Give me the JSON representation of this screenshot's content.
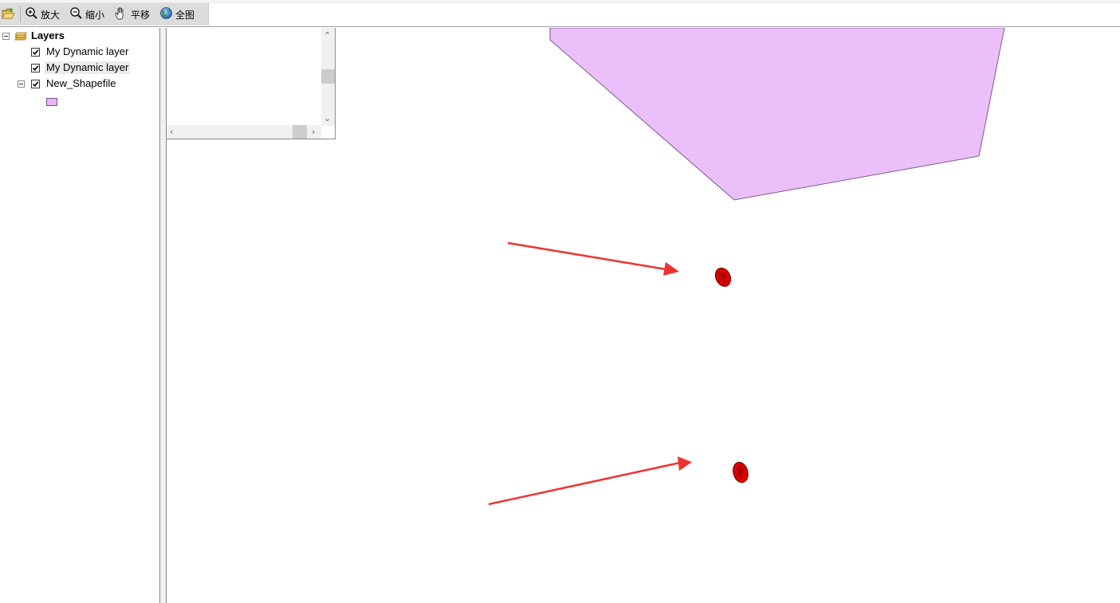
{
  "toolbar": {
    "zoom_in_label": "放大",
    "zoom_out_label": "缩小",
    "pan_label": "平移",
    "full_extent_label": "全图"
  },
  "toc": {
    "root_label": "Layers",
    "layers": [
      {
        "label": "My Dynamic layer",
        "checked": true
      },
      {
        "label": "My Dynamic layer",
        "checked": true
      },
      {
        "label": "New_Shapefile",
        "checked": true
      }
    ]
  },
  "colors": {
    "polygon_fill": "#ebbffa",
    "polygon_stroke": "#7d5a8c",
    "point_fill": "#dc0000",
    "arrow": "#ee3232",
    "legend_swatch": "#e8b8f5"
  },
  "icons": {
    "open": "folder-open-icon",
    "zoom_in": "zoom-in-icon",
    "zoom_out": "zoom-out-icon",
    "pan": "hand-icon",
    "full_extent": "globe-icon",
    "layers": "layers-icon"
  }
}
